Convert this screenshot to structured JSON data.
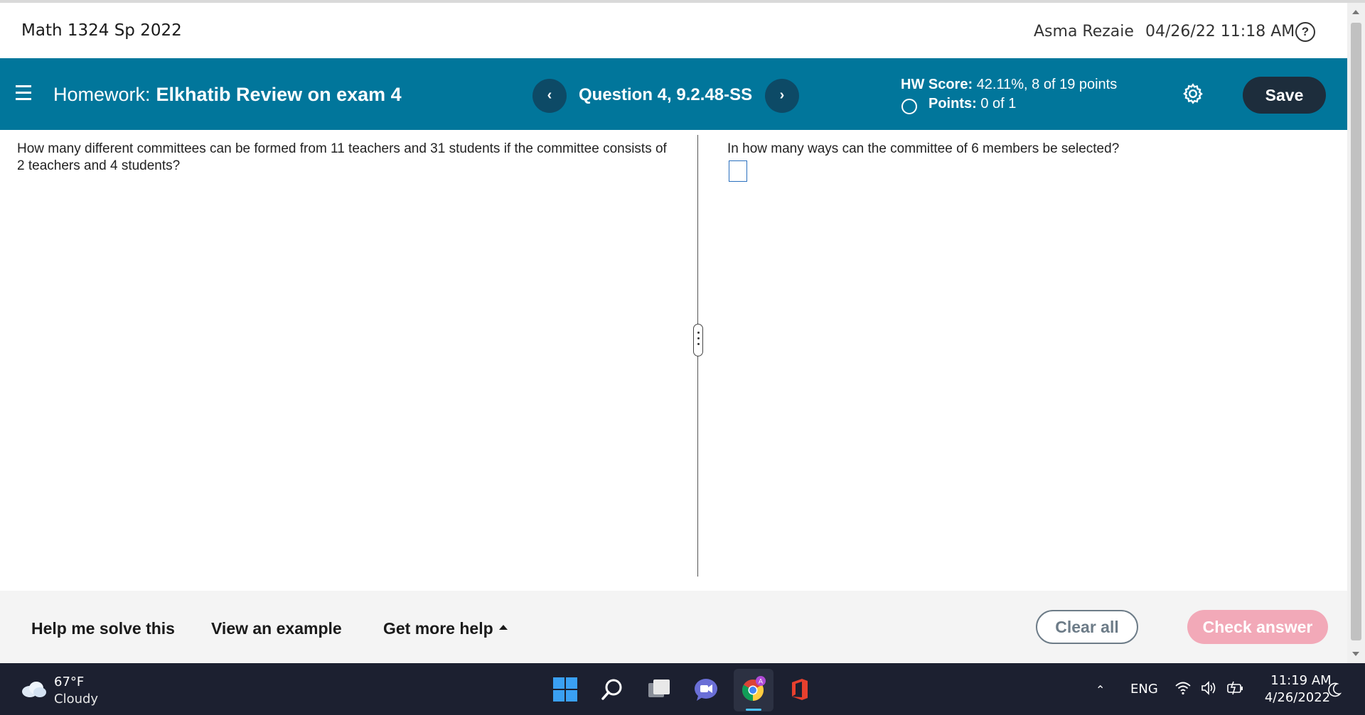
{
  "course": {
    "title": "Math 1324 Sp 2022",
    "user_name": "Asma Rezaie",
    "datetime": "04/26/22 11:18 AM",
    "help_icon": "question-circle-icon"
  },
  "header": {
    "homework_prefix": "Homework:",
    "homework_name": "Elkhatib Review on exam 4",
    "question_label": "Question 4, 9.2.48-SS",
    "prev_icon": "chevron-left-icon",
    "next_icon": "chevron-right-icon",
    "hw_score_label": "HW Score:",
    "hw_score_value": "42.11%, 8 of 19 points",
    "points_label": "Points:",
    "points_value": "0 of 1",
    "settings_icon": "gear-icon",
    "save_label": "Save",
    "accent_color": "#01769b"
  },
  "question": {
    "text": "How many different committees can be formed from 11 teachers and 31 students if the committee consists of 2 teachers and 4 students?"
  },
  "answer": {
    "prompt": "In how many ways can the committee of 6 members be selected?",
    "value": ""
  },
  "help_bar": {
    "help_solve": "Help me solve this",
    "view_example": "View an example",
    "more_help": "Get more help",
    "clear_all": "Clear all",
    "check_answer": "Check answer"
  },
  "taskbar": {
    "weather_temp": "67°F",
    "weather_condition": "Cloudy",
    "language": "ENG",
    "time": "11:19 AM",
    "date": "4/26/2022"
  }
}
